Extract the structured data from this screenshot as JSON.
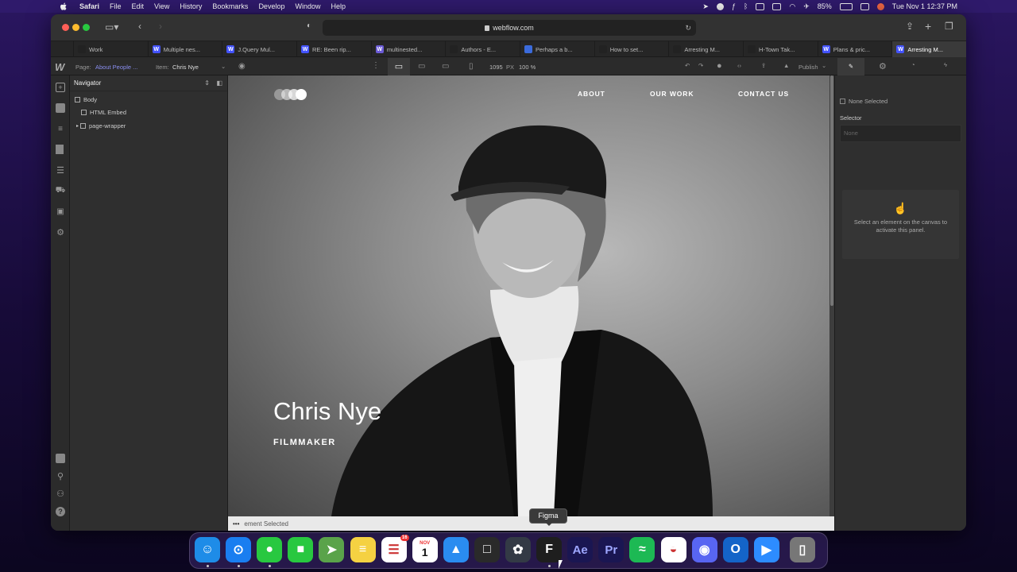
{
  "menubar": {
    "items": [
      "Safari",
      "File",
      "Edit",
      "View",
      "History",
      "Bookmarks",
      "Develop",
      "Window",
      "Help"
    ],
    "battery": "85%",
    "clock": "Tue Nov 1  12:37 PM"
  },
  "browser": {
    "url": "webflow.com",
    "tabs": [
      {
        "label": "Work",
        "icon": "webflow-icon",
        "color": "#222222"
      },
      {
        "label": "Multiple nes...",
        "icon": "webflow-w-icon",
        "color": "#4353ff"
      },
      {
        "label": "J.Query Mul...",
        "icon": "webflow-w-icon",
        "color": "#4353ff"
      },
      {
        "label": "RE: Been rip...",
        "icon": "webflow-w-icon",
        "color": "#4353ff"
      },
      {
        "label": "multinested...",
        "icon": "webflow-w-icon",
        "color": "#6b5bd6"
      },
      {
        "label": "Authors - E...",
        "icon": "page-icon",
        "color": "#222222"
      },
      {
        "label": "Perhaps a b...",
        "icon": "star-icon",
        "color": "#3b6bdc"
      },
      {
        "label": "How to set...",
        "icon": "page-icon",
        "color": "#222222"
      },
      {
        "label": "Arresting M...",
        "icon": "webflow-icon",
        "color": "#222222"
      },
      {
        "label": "H-Town Tak...",
        "icon": "webflow-icon",
        "color": "#222222"
      },
      {
        "label": "Plans & pric...",
        "icon": "webflow-w-icon",
        "color": "#4353ff"
      },
      {
        "label": "Arresting M...",
        "icon": "webflow-w-icon",
        "color": "#4353ff"
      }
    ]
  },
  "designer": {
    "page_label": "Page:",
    "page_value": "About People ...",
    "item_label": "Item:",
    "item_value": "Chris Nye",
    "width": "1095",
    "width_unit": "PX",
    "zoom": "100 %",
    "publish": "Publish"
  },
  "navigator": {
    "title": "Navigator",
    "items": [
      {
        "label": "Body",
        "indent": 0
      },
      {
        "label": "HTML Embed",
        "indent": 1
      },
      {
        "label": "page-wrapper",
        "indent": 1
      }
    ]
  },
  "site": {
    "nav": [
      "ABOUT",
      "OUR WORK",
      "CONTACT US"
    ],
    "name": "Chris Nye",
    "role": "FILMMAKER"
  },
  "status": {
    "text": "ement Selected"
  },
  "right_panel": {
    "none_selected": "None Selected",
    "selector_label": "Selector",
    "selector_placeholder": "None",
    "hint": "Select an element on the canvas to activate this panel."
  },
  "tooltip": "Figma",
  "dock": [
    {
      "name": "finder",
      "glyph": "☺",
      "color": "#1e8ce8",
      "running": true
    },
    {
      "name": "safari",
      "glyph": "⊙",
      "color": "#1a7ef0",
      "running": true
    },
    {
      "name": "messages",
      "glyph": "●",
      "color": "#28c840",
      "running": true
    },
    {
      "name": "facetime",
      "glyph": "■",
      "color": "#28c840",
      "running": false
    },
    {
      "name": "maps",
      "glyph": "➤",
      "color": "#5aa34a",
      "running": false
    },
    {
      "name": "notes",
      "glyph": "≡",
      "color": "#f5d142",
      "running": false
    },
    {
      "name": "reminders",
      "glyph": "☰",
      "color": "#ffffff",
      "running": false,
      "badge": "16"
    },
    {
      "name": "calendar",
      "glyph": "1",
      "color": "#ffffff",
      "running": false,
      "month": "NOV"
    },
    {
      "name": "keynote",
      "glyph": "▲",
      "color": "#2a8cf0",
      "running": false
    },
    {
      "name": "screenflow",
      "glyph": "□",
      "color": "#2a2a2a",
      "running": false
    },
    {
      "name": "davinci",
      "glyph": "✿",
      "color": "#333a45",
      "running": false
    },
    {
      "name": "figma",
      "glyph": "F",
      "color": "#1e1e1e",
      "running": true
    },
    {
      "name": "after-effects",
      "glyph": "Ae",
      "color": "#1a1652",
      "running": false
    },
    {
      "name": "premiere",
      "glyph": "Pr",
      "color": "#1a1652",
      "running": false
    },
    {
      "name": "spotify",
      "glyph": "≈",
      "color": "#1db954",
      "running": false
    },
    {
      "name": "mail-app",
      "glyph": "◒",
      "color": "#ffffff",
      "running": false
    },
    {
      "name": "discord",
      "glyph": "◉",
      "color": "#5865f2",
      "running": false
    },
    {
      "name": "outlook",
      "glyph": "O",
      "color": "#1464c8",
      "running": false
    },
    {
      "name": "zoom",
      "glyph": "▶",
      "color": "#2d8cff",
      "running": false
    },
    {
      "name": "trash",
      "glyph": "▯",
      "color": "#777777",
      "running": false
    }
  ]
}
